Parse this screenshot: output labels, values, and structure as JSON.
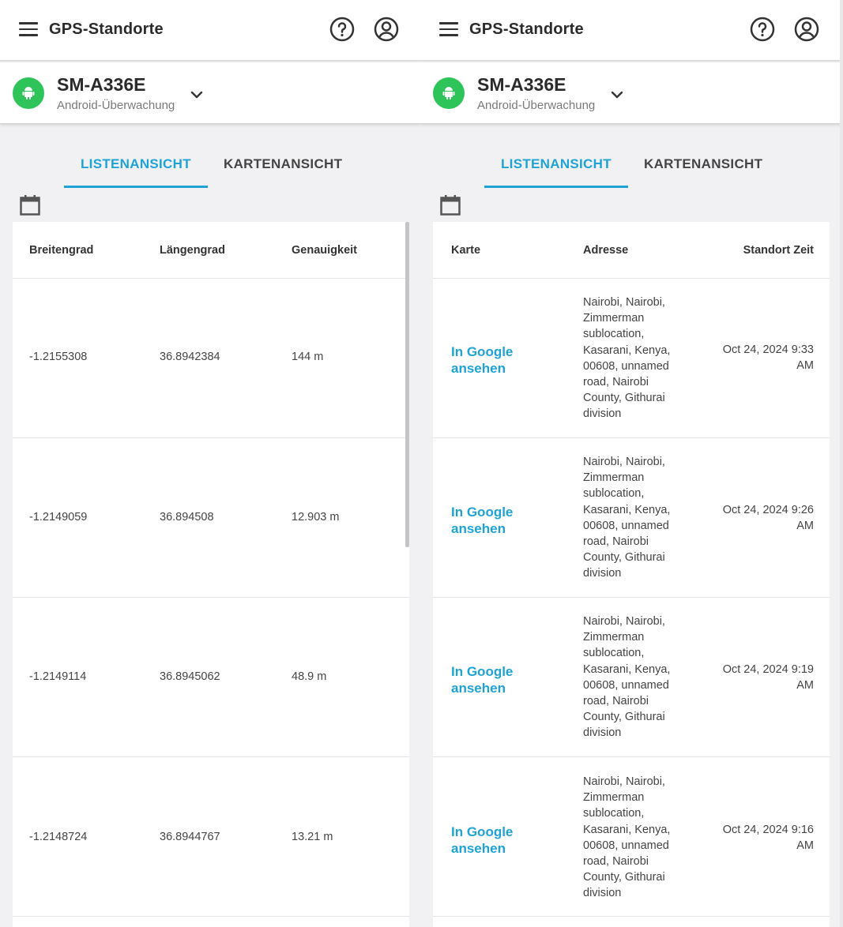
{
  "app": {
    "title": "GPS-Standorte"
  },
  "device": {
    "name": "SM-A336E",
    "subtitle": "Android-Überwachung"
  },
  "tabs": [
    {
      "label": "LISTENANSICHT",
      "active": true
    },
    {
      "label": "KARTENANSICHT",
      "active": false
    }
  ],
  "colors": {
    "accent": "#1fa3d6",
    "android_green": "#2fc45a"
  },
  "left_table": {
    "columns": [
      "Breitengrad",
      "Längengrad",
      "Genauigkeit"
    ],
    "rows": [
      {
        "lat": "-1.2155308",
        "lng": "36.8942384",
        "acc": "144 m"
      },
      {
        "lat": "-1.2149059",
        "lng": "36.894508",
        "acc": "12.903 m"
      },
      {
        "lat": "-1.2149114",
        "lng": "36.8945062",
        "acc": "48.9 m"
      },
      {
        "lat": "-1.2148724",
        "lng": "36.8944767",
        "acc": "13.21 m"
      }
    ]
  },
  "right_table": {
    "columns": [
      "Karte",
      "Adresse",
      "Standort Zeit"
    ],
    "rows": [
      {
        "map_link": [
          "In Google",
          "ansehen"
        ],
        "address": [
          "Nairobi, Nairobi,",
          "Zimmerman",
          "sublocation,",
          "Kasarani, Kenya,",
          "00608, unnamed",
          "road, Nairobi",
          "County, Githurai",
          "division"
        ],
        "time": [
          "Oct 24, 2024 9:33",
          "AM"
        ]
      },
      {
        "map_link": [
          "In Google",
          "ansehen"
        ],
        "address": [
          "Nairobi, Nairobi,",
          "Zimmerman",
          "sublocation,",
          "Kasarani, Kenya,",
          "00608, unnamed",
          "road, Nairobi",
          "County, Githurai",
          "division"
        ],
        "time": [
          "Oct 24, 2024 9:26",
          "AM"
        ]
      },
      {
        "map_link": [
          "In Google",
          "ansehen"
        ],
        "address": [
          "Nairobi, Nairobi,",
          "Zimmerman",
          "sublocation,",
          "Kasarani, Kenya,",
          "00608, unnamed",
          "road, Nairobi",
          "County, Githurai",
          "division"
        ],
        "time": [
          "Oct 24, 2024 9:19",
          "AM"
        ]
      },
      {
        "map_link": [
          "In Google",
          "ansehen"
        ],
        "address": [
          "Nairobi, Nairobi,",
          "Zimmerman",
          "sublocation,",
          "Kasarani, Kenya,",
          "00608, unnamed",
          "road, Nairobi",
          "County, Githurai",
          "division"
        ],
        "time": [
          "Oct 24, 2024 9:16",
          "AM"
        ]
      }
    ]
  }
}
